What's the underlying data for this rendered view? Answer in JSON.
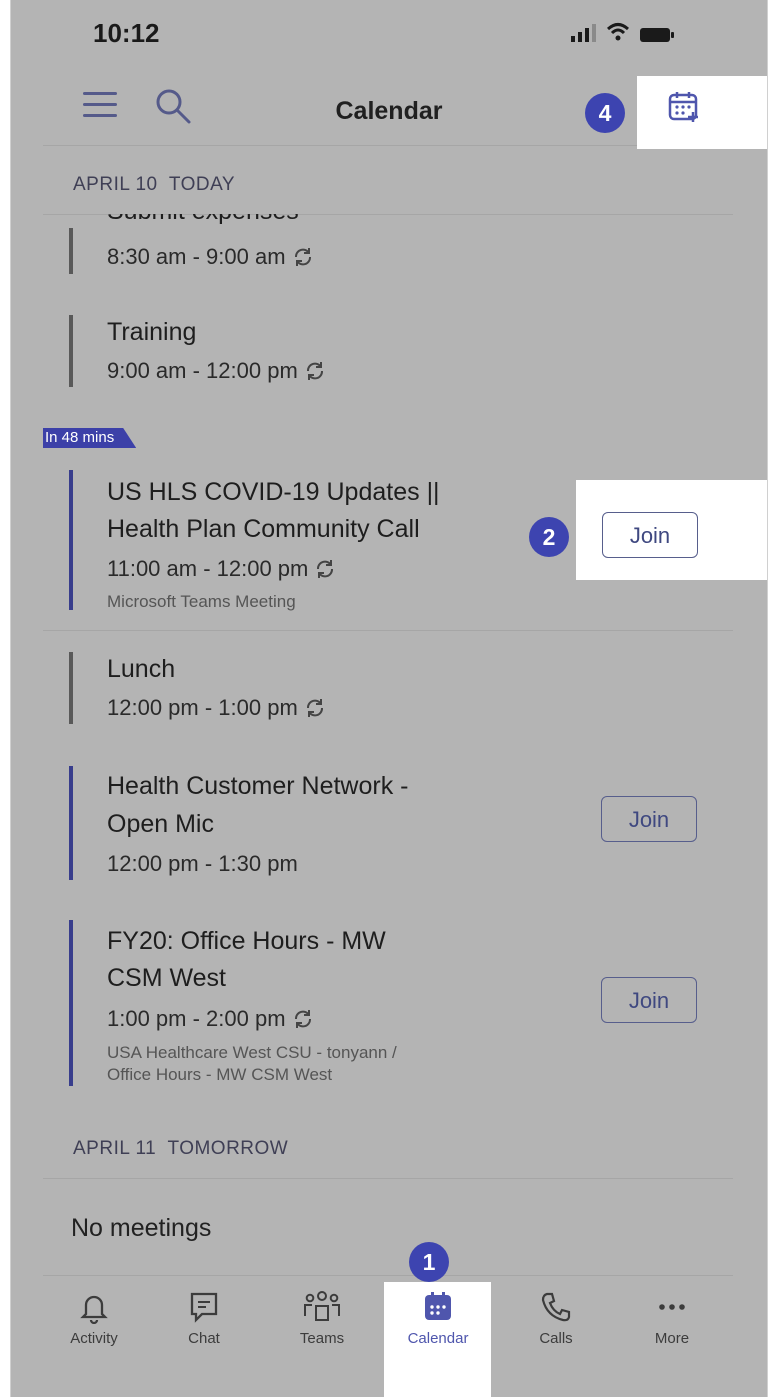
{
  "status_bar": {
    "time": "10:12"
  },
  "header": {
    "title": "Calendar",
    "new_event_callout": "4"
  },
  "sections": [
    {
      "date": "APRIL 10",
      "label": "TODAY"
    },
    {
      "date": "APRIL 11",
      "label": "TOMORROW"
    }
  ],
  "badge": "In 48 mins",
  "events": [
    {
      "title": "Submit expenses",
      "time": "8:30 am - 9:00 am",
      "recurring": true
    },
    {
      "title": "Training",
      "time": "9:00 am - 12:00 pm",
      "recurring": true
    },
    {
      "title_line1": "US HLS COVID-19 Updates ||",
      "title_line2": "Health Plan Community Call",
      "time": "11:00 am - 12:00 pm",
      "location": "Microsoft Teams Meeting",
      "join": "Join",
      "callout": "2",
      "recurring": true
    },
    {
      "title": "Lunch",
      "time": "12:00 pm - 1:00 pm",
      "recurring": true
    },
    {
      "title_line1": "Health Customer Network -",
      "title_line2": "Open Mic",
      "time": "12:00 pm - 1:30 pm",
      "join": "Join"
    },
    {
      "title_line1": "FY20: Office Hours - MW",
      "title_line2": "CSM West",
      "time": "1:00 pm - 2:00 pm",
      "location_line1": "USA Healthcare West CSU - tonyann /",
      "location_line2": "Office Hours - MW CSM West",
      "join": "Join",
      "recurring": true
    }
  ],
  "no_meetings": "No meetings",
  "tabs": [
    {
      "label": "Activity",
      "icon": "bell-icon"
    },
    {
      "label": "Chat",
      "icon": "chat-icon"
    },
    {
      "label": "Teams",
      "icon": "teams-icon"
    },
    {
      "label": "Calendar",
      "icon": "calendar-icon",
      "active": true,
      "callout": "1"
    },
    {
      "label": "Calls",
      "icon": "phone-icon"
    },
    {
      "label": "More",
      "icon": "more-icon"
    }
  ],
  "colors": {
    "accent": "#3d44b0",
    "overlay": "#b4b4b4",
    "event_bar_teams": "#383d8c",
    "event_bar_other": "#595959"
  }
}
